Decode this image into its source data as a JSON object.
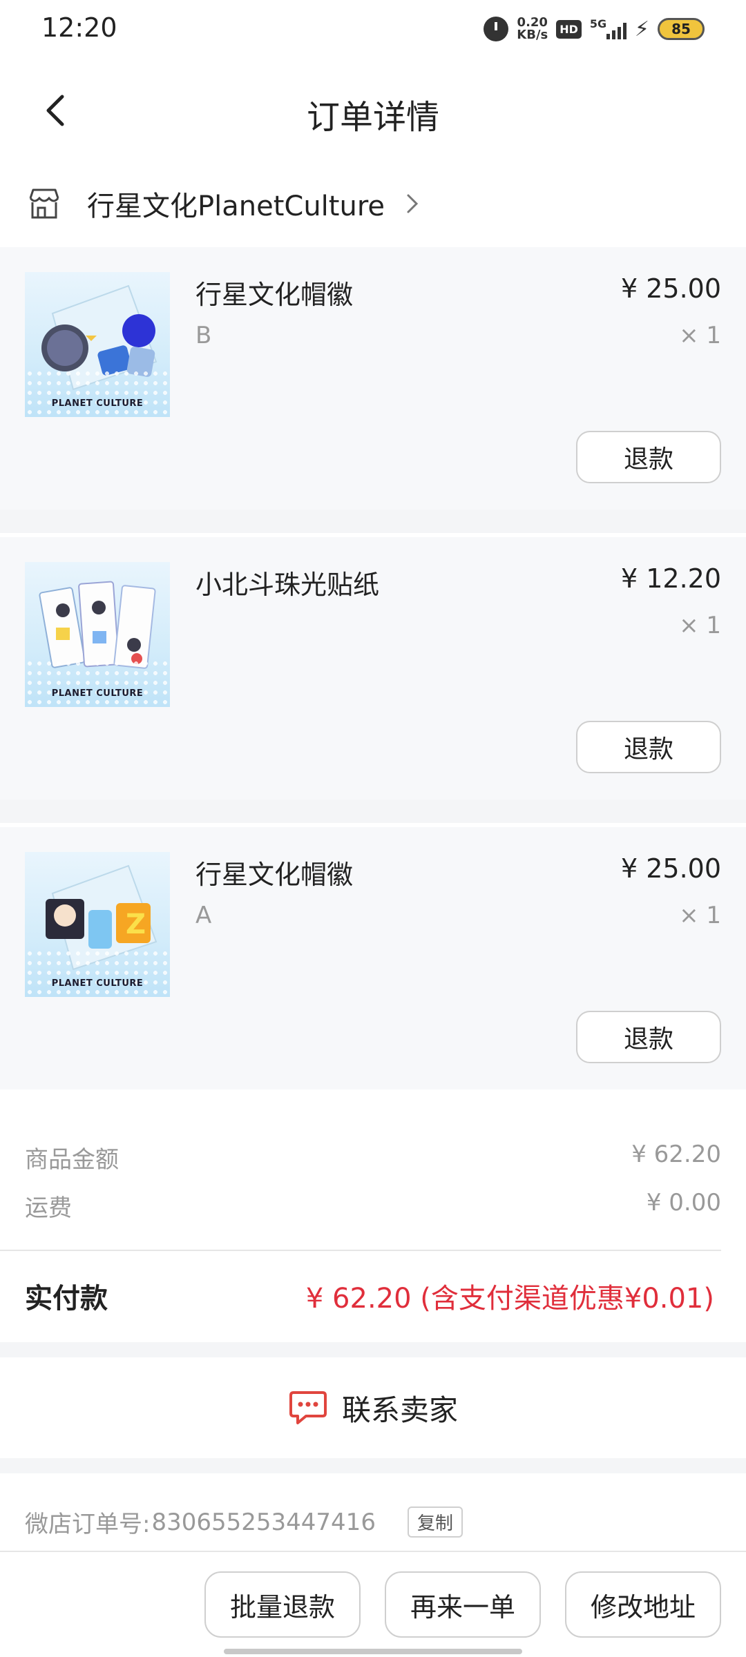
{
  "status_bar": {
    "time": "12:20",
    "net_speed_value": "0.20",
    "net_speed_unit": "KB/s",
    "hd_label": "HD",
    "network_label": "5G",
    "battery": "85"
  },
  "header": {
    "title": "订单详情"
  },
  "store": {
    "name": "行星文化PlanetCulture"
  },
  "items": [
    {
      "name": "行星文化帽徽",
      "variant": "B",
      "price": "¥ 25.00",
      "qty": "× 1",
      "refund_label": "退款",
      "thumb_brand": "PLANET CULTURE"
    },
    {
      "name": "小北斗珠光贴纸",
      "variant": "",
      "price": "¥ 12.20",
      "qty": "× 1",
      "refund_label": "退款",
      "thumb_brand": "PLANET CULTURE"
    },
    {
      "name": "行星文化帽徽",
      "variant": "A",
      "price": "¥ 25.00",
      "qty": "× 1",
      "refund_label": "退款",
      "thumb_brand": "PLANET CULTURE"
    }
  ],
  "summary": {
    "goods_label": "商品金额",
    "goods_value": "¥ 62.20",
    "shipping_label": "运费",
    "shipping_value": "¥ 0.00",
    "paid_label": "实付款",
    "paid_value": "¥ 62.20 (含支付渠道优惠¥0.01)"
  },
  "contact": {
    "label": "联系卖家"
  },
  "order": {
    "label": "微店订单号:",
    "number": "830655253447416",
    "copy_label": "复制"
  },
  "bottom_bar": {
    "batch_refund": "批量退款",
    "reorder": "再来一单",
    "edit_address": "修改地址"
  },
  "colors": {
    "accent_red": "#e02e3b",
    "muted_text": "#999999",
    "item_bg": "#f7f8fa"
  }
}
